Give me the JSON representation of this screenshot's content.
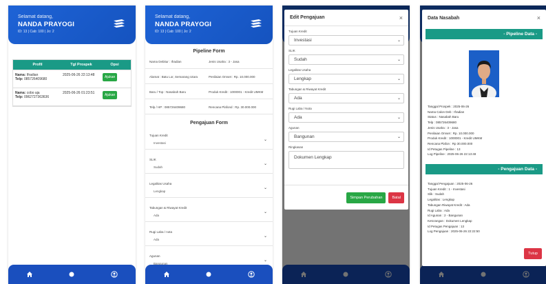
{
  "header": {
    "welcome": "Selamat datang,",
    "user_name": "NANDA PRAYOGI",
    "user_meta": "ID: 13 | Cab: 100 | Jo: 2"
  },
  "table": {
    "headers": [
      "Profil",
      "Tgl Prospek",
      "Opsi"
    ],
    "rows": [
      {
        "name_label": "Nama:",
        "name": "Ifradian",
        "phone_label": "Telp:",
        "phone": "085726409680",
        "date": "2025-06-26 22:13:48",
        "action": "Ajukan"
      },
      {
        "name_label": "Nama:",
        "name": "cobo aja",
        "phone_label": "Telp:",
        "phone": "0962727363636",
        "date": "2025-06-26 01:23:51",
        "action": "Ajukan"
      }
    ]
  },
  "pipeline_form": {
    "title": "Pipeline Form",
    "rows": [
      {
        "left": "Nama Debitur : Ifradian",
        "right": "Jenis Usaha : 3 - Jasa"
      },
      {
        "left": "Alamat : Batu Lor, Semarang Utara",
        "right": "Penilaian Omset : Rp. 10.000.000"
      },
      {
        "left": "Baru / Top : Nasabah Baru",
        "right": "Produk Kredit : 1000001 - Kredit UMKM"
      },
      {
        "left": "Telp / HP : 085726409680",
        "right": "Rencana Plafond : Rp. 30.000.000"
      }
    ]
  },
  "pengajuan_form": {
    "title": "Pengajuan Form",
    "fields": [
      {
        "label": "Tujuan Kredit",
        "value": "Investasi"
      },
      {
        "label": "SLIK",
        "value": "Sudah"
      },
      {
        "label": "Legalitas Usaha",
        "value": "Lengkap"
      },
      {
        "label": "Tabungan & Riwayat Kredit",
        "value": "Ada"
      },
      {
        "label": "Rugi Laba / nota",
        "value": "Ada"
      },
      {
        "label": "Agunan",
        "value": "Bangunan"
      }
    ]
  },
  "edit_modal": {
    "title": "Edit Pengajuan",
    "close": "×",
    "fields": [
      {
        "label": "Tujuan Kredit",
        "value": "Investasi"
      },
      {
        "label": "SLIK",
        "value": "Sudah"
      },
      {
        "label": "Legalitas Usaha",
        "value": "Lengkap"
      },
      {
        "label": "Tabungan & Riwayat Kredit",
        "value": "Ada"
      },
      {
        "label": "Rugi Laba / Nota",
        "value": "Ada"
      },
      {
        "label": "Agunan",
        "value": "Bangunan"
      }
    ],
    "ringkasan_label": "Ringkasan",
    "ringkasan_value": "Dokumen Lengkap",
    "save_label": "Simpan Perubahan",
    "cancel_label": "Batal"
  },
  "detail_modal": {
    "title": "Data Nasabah",
    "close": "×",
    "pipeline_banner": "- Pipeline Data -",
    "pipeline_lines": [
      "Tanggal Prospek : 2025-06-26",
      "Nama Calon Deb : Ifradian",
      "Status : Nasabah Baru",
      "Telp : 085726409680",
      "Jenis Usaha : 3 - Jasa",
      "Penilaian Omset : Rp. 10.000.000",
      "Produk Kredit : 1000001 - Kredit UMKM",
      "Rencana Plafon : Rp 30.000.000",
      "Id Petugas Pipeline : 13",
      "Log Pipeline : 2025-06-26 22:13:48"
    ],
    "pengajuan_banner": "- Pengajuan Data -",
    "pengajuan_lines": [
      "Tanggal Pengajuan : 2025-06-26",
      "Tujuan Kredit : 1 - Investasi",
      "Slik : Sudah",
      "Legalitas : Lengkap",
      "Tabungan Riwayat Kredit : Ada",
      "Rugi Laba : Ada",
      "Id Agunan : 2 - Bangunan",
      "Ketcrangan : Dokumen Lengkap",
      "Id Petugas Pengajuan : 13",
      "Log Pengajuan : 2025-06-26 22:22:50"
    ],
    "close_button": "Tutup"
  },
  "icons": {
    "nav": [
      "home-icon",
      "dot-icon",
      "user-circle-icon"
    ],
    "logo": "bank-logo-icon",
    "chevron": "chevron-down-icon"
  },
  "colors": {
    "primary": "#1a4fbe",
    "teal": "#1a9a86",
    "green": "#28a745",
    "red": "#dc3545"
  }
}
